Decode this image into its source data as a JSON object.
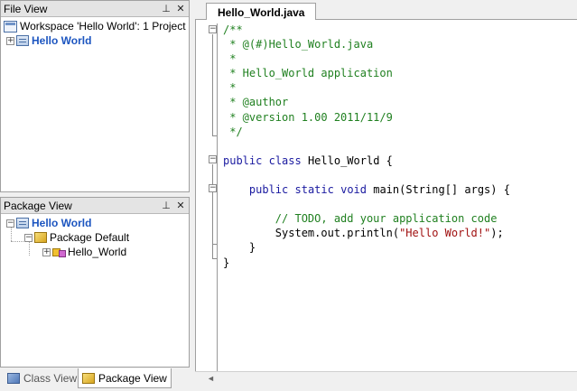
{
  "file_view": {
    "title": "File View",
    "pin_icon": "pin-icon",
    "close_icon": "close-icon",
    "workspace_label": "Workspace 'Hello World': 1 Project",
    "project_label": "Hello World",
    "expander_collapsed": "+"
  },
  "package_view": {
    "title": "Package View",
    "project_label": "Hello World",
    "package_label": "Package Default",
    "class_label": "Hello_World",
    "expander_expanded": "−",
    "expander_collapsed": "+"
  },
  "bottom_tabs": [
    {
      "label": "Class View",
      "active": false
    },
    {
      "label": "Package View",
      "active": true
    }
  ],
  "editor": {
    "tab_label": "Hello_World.java",
    "fold_open": "−",
    "lines": [
      [
        {
          "t": "/**",
          "c": "cm"
        }
      ],
      [
        {
          "t": " * @(#)Hello_World.java",
          "c": "cm"
        }
      ],
      [
        {
          "t": " *",
          "c": "cm"
        }
      ],
      [
        {
          "t": " * Hello_World application",
          "c": "cm"
        }
      ],
      [
        {
          "t": " *",
          "c": "cm"
        }
      ],
      [
        {
          "t": " * @author",
          "c": "cm"
        }
      ],
      [
        {
          "t": " * @version 1.00 2011/11/9",
          "c": "cm"
        }
      ],
      [
        {
          "t": " */",
          "c": "cm"
        }
      ],
      [],
      [
        {
          "t": "public",
          "c": "kw"
        },
        {
          "t": " ",
          "c": "tx"
        },
        {
          "t": "class",
          "c": "kw"
        },
        {
          "t": " Hello_World {",
          "c": "tx"
        }
      ],
      [],
      [
        {
          "t": "    ",
          "c": "tx"
        },
        {
          "t": "public",
          "c": "kw"
        },
        {
          "t": " ",
          "c": "tx"
        },
        {
          "t": "static",
          "c": "kw"
        },
        {
          "t": " ",
          "c": "tx"
        },
        {
          "t": "void",
          "c": "kw"
        },
        {
          "t": " main(String[] args) {",
          "c": "tx"
        }
      ],
      [],
      [
        {
          "t": "        // TODO, add your application code",
          "c": "cm"
        }
      ],
      [
        {
          "t": "        System.out.println(",
          "c": "tx"
        },
        {
          "t": "\"Hello World!\"",
          "c": "str"
        },
        {
          "t": ");",
          "c": "tx"
        }
      ],
      [
        {
          "t": "    }",
          "c": "tx"
        }
      ],
      [
        {
          "t": "}",
          "c": "tx"
        }
      ]
    ]
  },
  "colors": {
    "comment": "#208020",
    "keyword": "#1a1aa0",
    "string": "#a01010",
    "project_text": "#1c55c0"
  }
}
